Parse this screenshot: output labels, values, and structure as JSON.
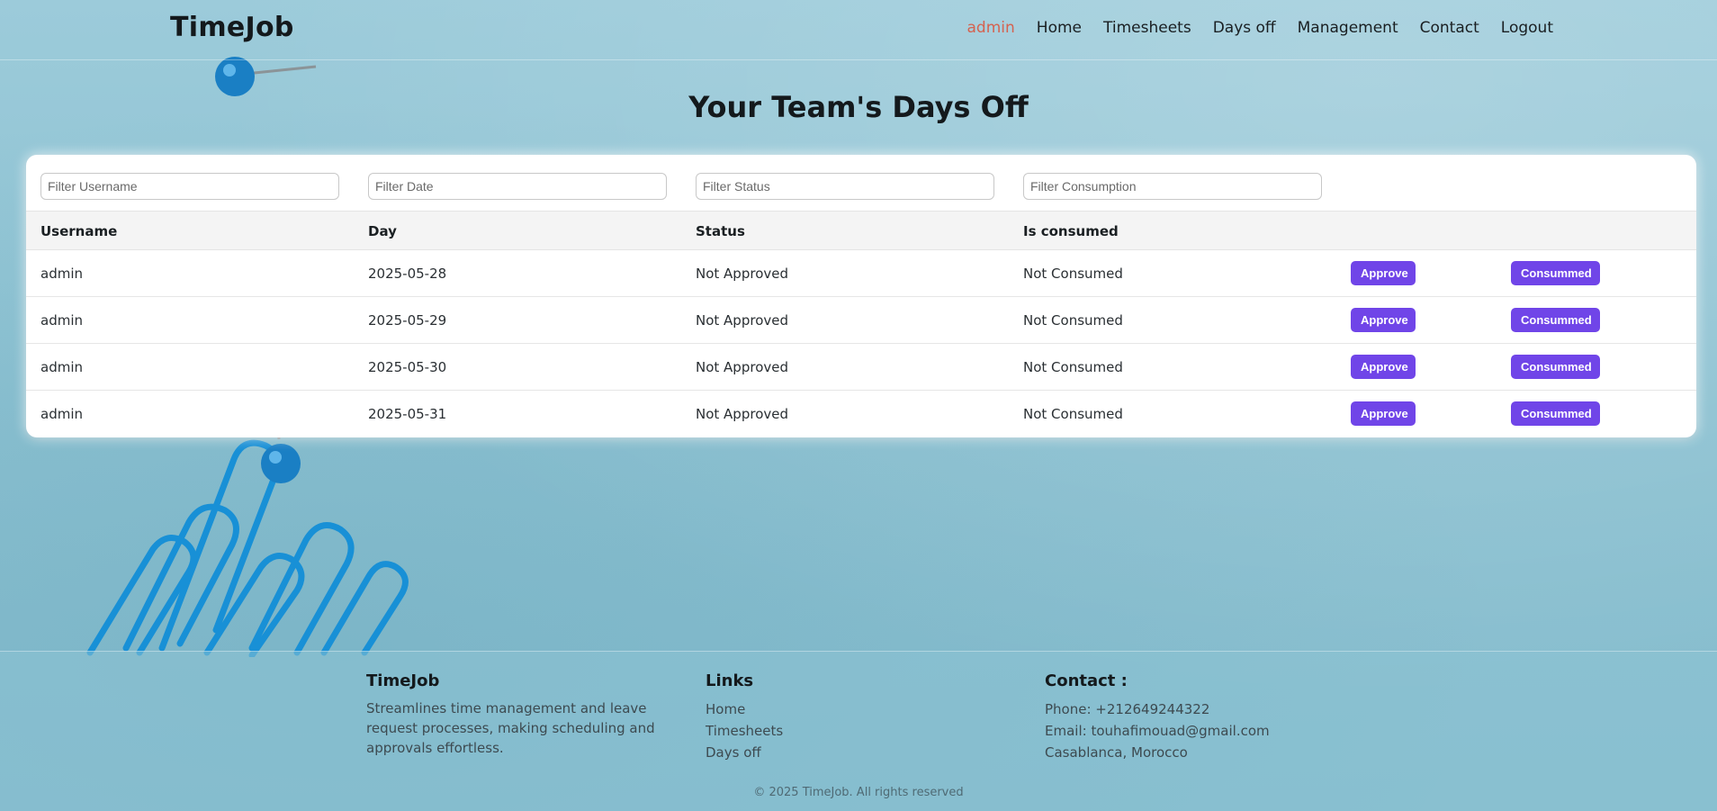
{
  "app": {
    "name": "TimeJob"
  },
  "nav": {
    "items": [
      {
        "label": "admin",
        "active": true
      },
      {
        "label": "Home"
      },
      {
        "label": "Timesheets"
      },
      {
        "label": "Days off"
      },
      {
        "label": "Management"
      },
      {
        "label": "Contact"
      },
      {
        "label": "Logout"
      }
    ]
  },
  "page": {
    "title": "Your Team's Days Off"
  },
  "filters": {
    "username_placeholder": "Filter Username",
    "date_placeholder": "Filter Date",
    "status_placeholder": "Filter Status",
    "consumption_placeholder": "Filter Consumption"
  },
  "table": {
    "columns": [
      "Username",
      "Day",
      "Status",
      "Is consumed"
    ],
    "approve_label": "Approve",
    "consumed_label": "Consummed",
    "rows": [
      {
        "username": "admin",
        "day": "2025-05-28",
        "status": "Not Approved",
        "consumed": "Not Consumed"
      },
      {
        "username": "admin",
        "day": "2025-05-29",
        "status": "Not Approved",
        "consumed": "Not Consumed"
      },
      {
        "username": "admin",
        "day": "2025-05-30",
        "status": "Not Approved",
        "consumed": "Not Consumed"
      },
      {
        "username": "admin",
        "day": "2025-05-31",
        "status": "Not Approved",
        "consumed": "Not Consumed"
      }
    ]
  },
  "footer": {
    "brand": {
      "title": "TimeJob",
      "description": "Streamlines time management and leave request processes, making scheduling and approvals effortless."
    },
    "links": {
      "title": "Links",
      "items": [
        "Home",
        "Timesheets",
        "Days off"
      ]
    },
    "contact": {
      "title": "Contact :",
      "phone": "Phone: +212649244322",
      "email": "Email: touhafimouad@gmail.com",
      "location": "Casablanca, Morocco"
    },
    "copyright": "© 2025 TimeJob. All rights reserved"
  },
  "colors": {
    "accent": "#7045e8",
    "active_nav": "#d5624f",
    "background": "#8fc3d3"
  }
}
